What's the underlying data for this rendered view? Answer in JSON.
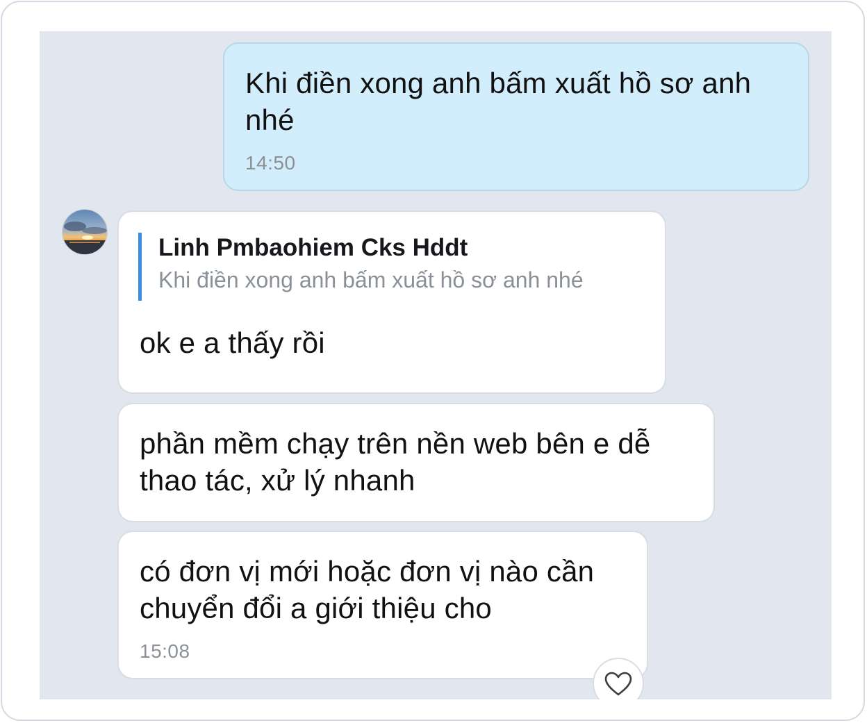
{
  "messages": {
    "outgoing_1": {
      "text": "Khi điền xong anh bấm xuất hồ sơ anh nhé",
      "time": "14:50"
    },
    "incoming_1": {
      "reply_to": {
        "name": "Linh Pmbaohiem Cks Hddt",
        "text": "Khi điền xong anh bấm xuất hồ sơ anh nhé"
      },
      "text": "ok e a thấy rồi"
    },
    "incoming_2": {
      "text": "phần mềm chạy trên nền web bên e dễ thao tác, xử lý nhanh"
    },
    "incoming_3": {
      "text": "có đơn vị mới hoặc đơn vị nào cần chuyển đổi a giới thiệu cho",
      "time": "15:08"
    }
  },
  "icons": {
    "like": "heart-icon",
    "avatar": "avatar-sunset"
  },
  "colors": {
    "chat_background": "#e2e7ef",
    "outgoing_bubble": "#d2edfb",
    "incoming_bubble": "#ffffff",
    "quote_accent": "#3a8fe0",
    "timestamp": "#8c9198"
  }
}
